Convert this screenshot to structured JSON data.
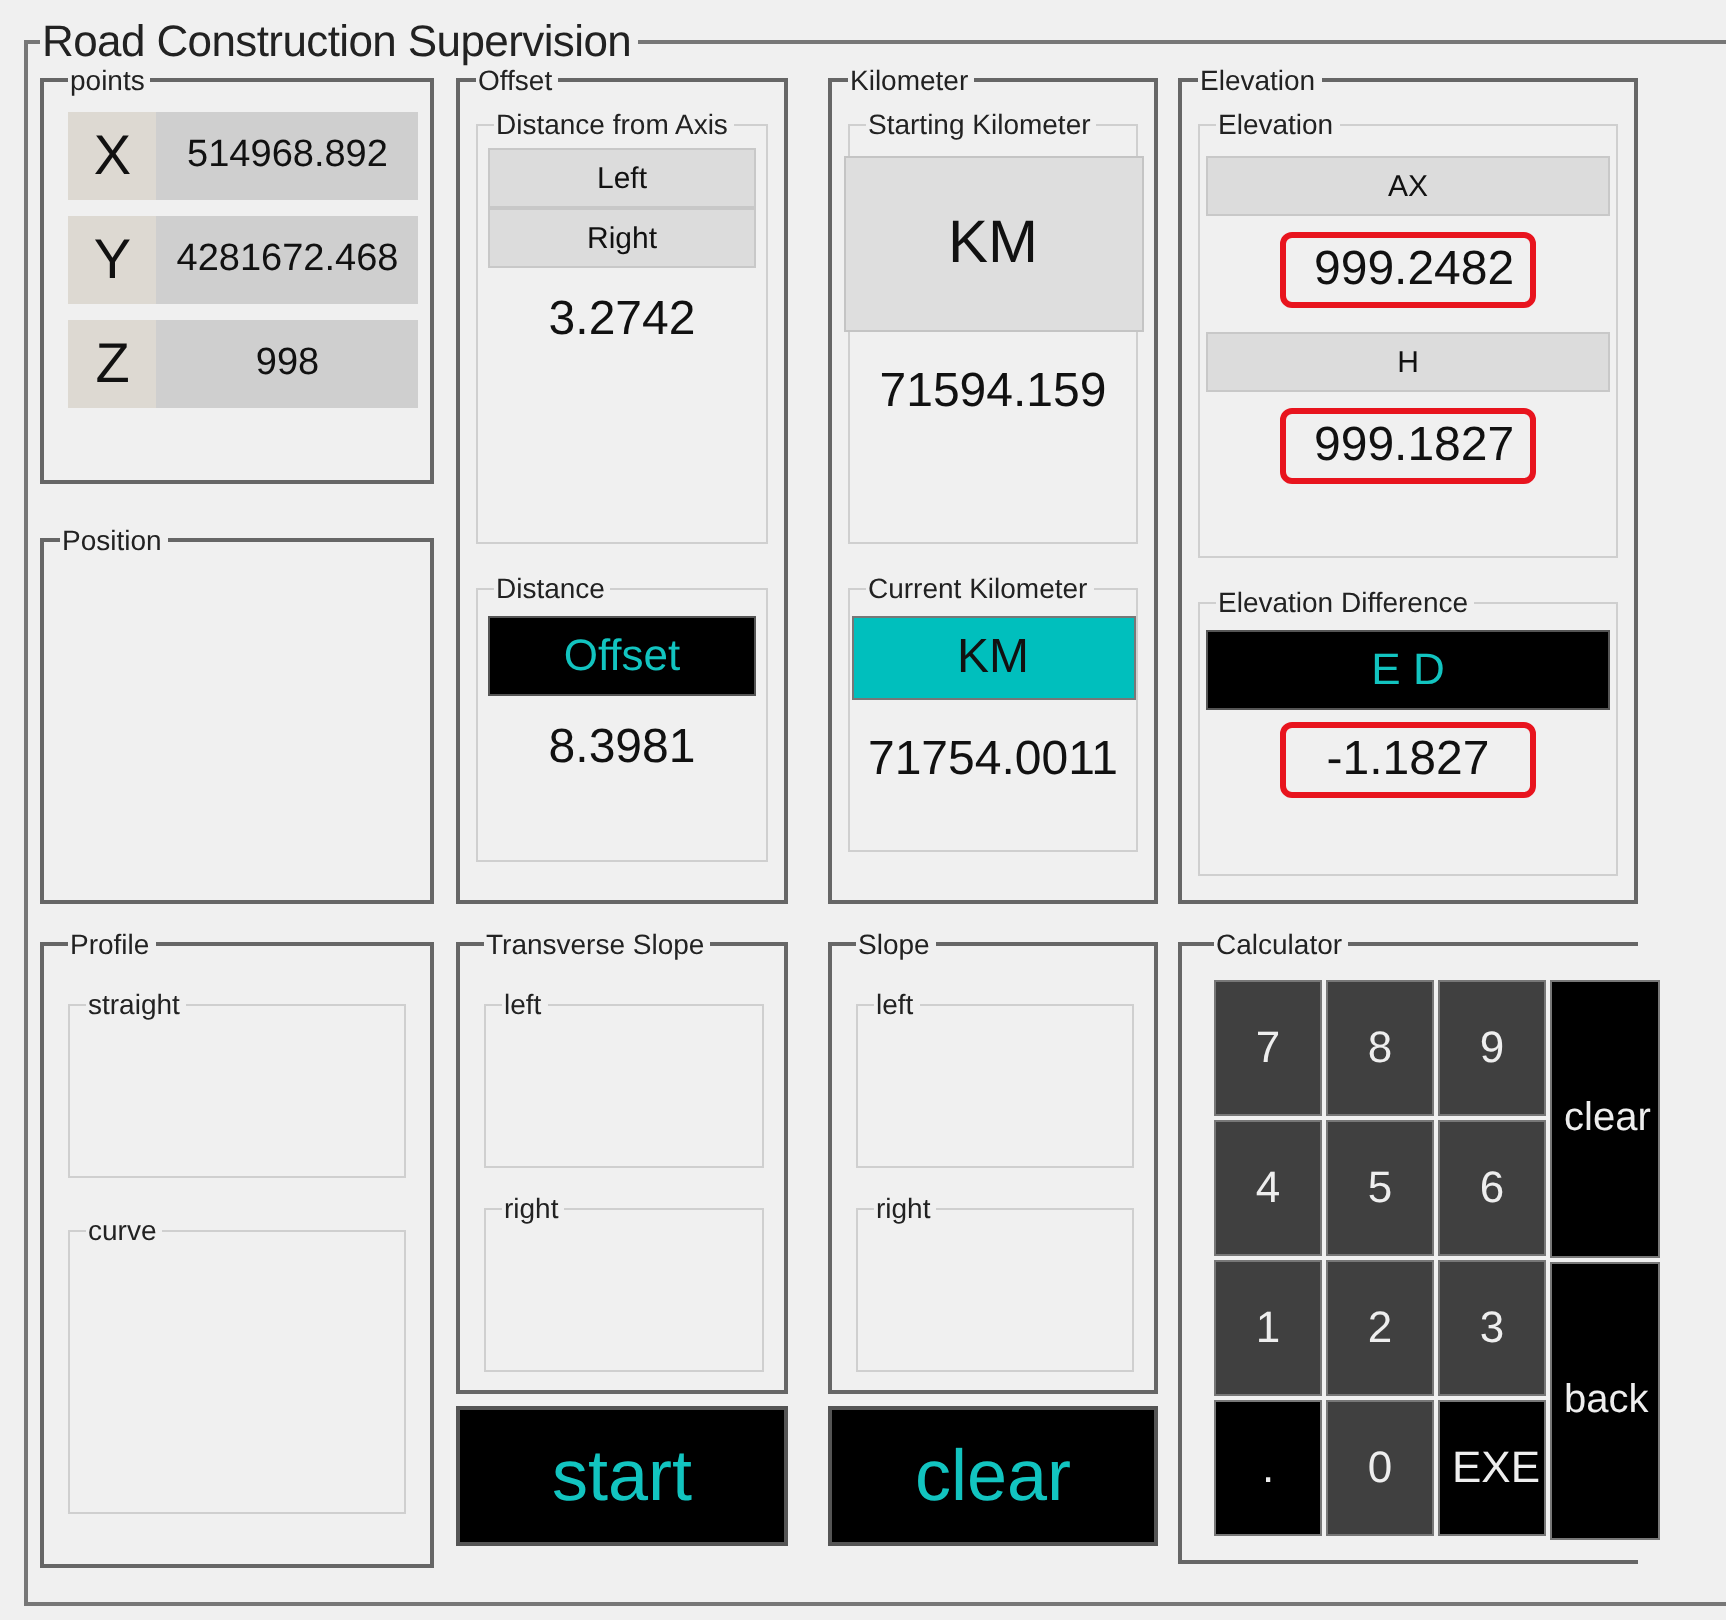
{
  "title": "Road Construction Supervision",
  "points": {
    "title": "points",
    "rows": [
      {
        "axis": "X",
        "value": "514968.892"
      },
      {
        "axis": "Y",
        "value": "4281672.468"
      },
      {
        "axis": "Z",
        "value": "998"
      }
    ]
  },
  "position": {
    "title": "Position"
  },
  "offset": {
    "title": "Offset",
    "distance_from_axis": {
      "title": "Distance from Axis",
      "left_button": "Left",
      "right_button": "Right",
      "value": "3.2742"
    },
    "distance": {
      "title": "Distance",
      "button": "Offset",
      "value": "8.3981"
    }
  },
  "kilometer": {
    "title": "Kilometer",
    "starting": {
      "title": "Starting Kilometer",
      "button": "KM",
      "value": "71594.159"
    },
    "current": {
      "title": "Current Kilometer",
      "button": "KM",
      "value": "71754.0011"
    }
  },
  "elevation": {
    "title": "Elevation",
    "elevation": {
      "title": "Elevation",
      "items": [
        {
          "label": "AX",
          "value": "999.2482"
        },
        {
          "label": "H",
          "value": "999.1827"
        }
      ]
    },
    "difference": {
      "title": "Elevation Difference",
      "button": "E D",
      "value": "-1.1827"
    }
  },
  "profile": {
    "title": "Profile",
    "groups": [
      "straight",
      "curve"
    ]
  },
  "transverse_slope": {
    "title": "Transverse Slope",
    "groups": [
      "left",
      "right"
    ]
  },
  "slope": {
    "title": "Slope",
    "groups": [
      "left",
      "right"
    ]
  },
  "actions": [
    "start",
    "clear"
  ],
  "calculator": {
    "title": "Calculator",
    "keys": [
      {
        "label": "7",
        "kind": "digit"
      },
      {
        "label": "8",
        "kind": "digit"
      },
      {
        "label": "9",
        "kind": "digit"
      },
      {
        "label": "4",
        "kind": "digit"
      },
      {
        "label": "5",
        "kind": "digit"
      },
      {
        "label": "6",
        "kind": "digit"
      },
      {
        "label": "1",
        "kind": "digit"
      },
      {
        "label": "2",
        "kind": "digit"
      },
      {
        "label": "3",
        "kind": "digit"
      },
      {
        "label": ".",
        "kind": "function"
      },
      {
        "label": "0",
        "kind": "digit"
      },
      {
        "label": "EXE",
        "kind": "function"
      }
    ],
    "side_keys": [
      "clear",
      "back"
    ]
  }
}
